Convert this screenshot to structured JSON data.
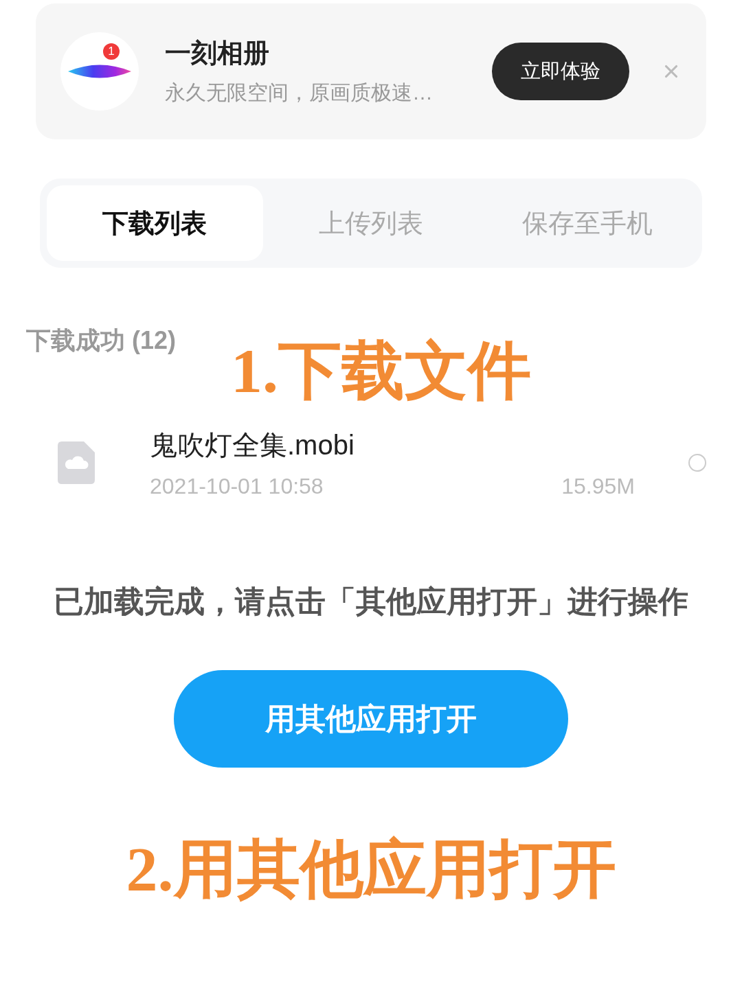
{
  "promo": {
    "app_name": "一刻相册",
    "description": "永久无限空间，原画质极速…",
    "badge": "1",
    "button": "立即体验"
  },
  "tabs": [
    {
      "label": "下载列表",
      "selected": true
    },
    {
      "label": "上传列表",
      "selected": false
    },
    {
      "label": "保存至手机",
      "selected": false
    }
  ],
  "section": {
    "title": "下载成功 (12)"
  },
  "files": [
    {
      "name": "鬼吹灯全集.mobi",
      "date": "2021-10-01 10:58",
      "size": "15.95M",
      "checked": false
    }
  ],
  "message": "已加载完成，请点击「其他应用打开」进行操作",
  "open_button": "用其他应用打开",
  "annotations": [
    {
      "text": "1.下载文件"
    },
    {
      "text": "2.用其他应用打开"
    }
  ]
}
